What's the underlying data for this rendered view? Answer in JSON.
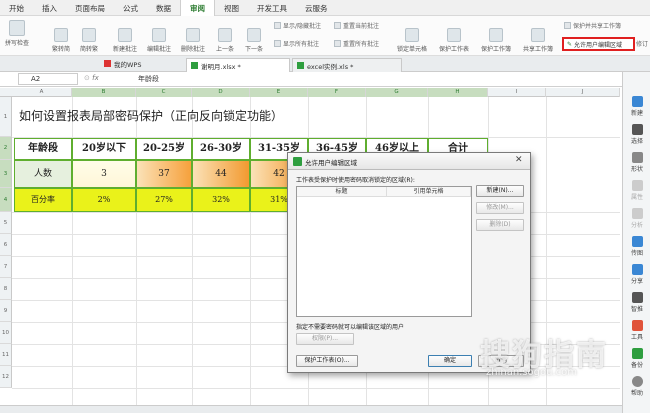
{
  "menu": [
    "开始",
    "插入",
    "页面布局",
    "公式",
    "数据",
    "审阅",
    "视图",
    "开发工具",
    "云服务"
  ],
  "menu_active": 5,
  "ribbon": {
    "spell": "拼写检查",
    "trad_simp": "繁转简",
    "simp_trad": "简转繁",
    "new_comment": "新建批注",
    "edit_comment": "编辑批注",
    "delete_comment": "删除批注",
    "prev": "上一条",
    "next": "下一条",
    "show_hide_comment": "显示/隐藏批注",
    "reset_comment": "重置当前批注",
    "show_all_comments": "显示所有批注",
    "reset_all_comments": "重置所有批注",
    "lock_cell": "锁定单元格",
    "protect_sheet": "保护工作表",
    "protect_workbook": "保护工作簿",
    "share_workbook": "共享工作簿",
    "protect_share": "保护并共享工作簿",
    "allow_edit_ranges": "允许用户编辑区域",
    "more": "修订"
  },
  "doc_tabs": [
    "我的WPS",
    "谢明月.xlsx *",
    "excel实例.xls *"
  ],
  "formula": {
    "cell_ref": "A2",
    "fx": "fx",
    "value": "年龄段"
  },
  "columns": [
    "A",
    "B",
    "C",
    "D",
    "E",
    "F",
    "G",
    "H",
    "I",
    "J"
  ],
  "rows": [
    "1",
    "2",
    "3",
    "4",
    "5",
    "6",
    "7",
    "8",
    "9",
    "10",
    "11",
    "12"
  ],
  "sheet": {
    "title": "如何设置报表局部密码保护（正向反向锁定功能）",
    "headers": [
      "年龄段",
      "20岁以下",
      "20-25岁",
      "26-30岁",
      "31-35岁",
      "36-45岁",
      "46岁以上",
      "合计"
    ],
    "row3": [
      "人数",
      "3",
      "37",
      "44",
      "42"
    ],
    "row4": [
      "百分率",
      "2%",
      "27%",
      "32%",
      "31%"
    ]
  },
  "right_panel": [
    "新建",
    "选择",
    "形状",
    "属性",
    "分析",
    "传图",
    "分享",
    "智推",
    "工具",
    "备份",
    "帮助"
  ],
  "dialog": {
    "title": "允许用户编辑区域",
    "desc": "工作表受保护时使用密码取消锁定的区域(R):",
    "col_title": "标题",
    "col_ref": "引用单元格",
    "btn_new": "新建(N)...",
    "btn_modify": "修改(M)...",
    "btn_delete": "删除(D)",
    "no_pwd": "指定不需要密码就可以编辑该区域的用户",
    "btn_perm": "权限(P)...",
    "btn_protect": "保护工作表(O)...",
    "btn_ok": "确定",
    "btn_cancel": "取消"
  },
  "watermark": {
    "text": "搜狗指南",
    "url": "zhinan.sogou.com"
  },
  "colors": {
    "accent": "#2e7d32",
    "header_fill": "#c7ddbf",
    "yellow": "#eaf21a",
    "highlight": "#e02020"
  }
}
